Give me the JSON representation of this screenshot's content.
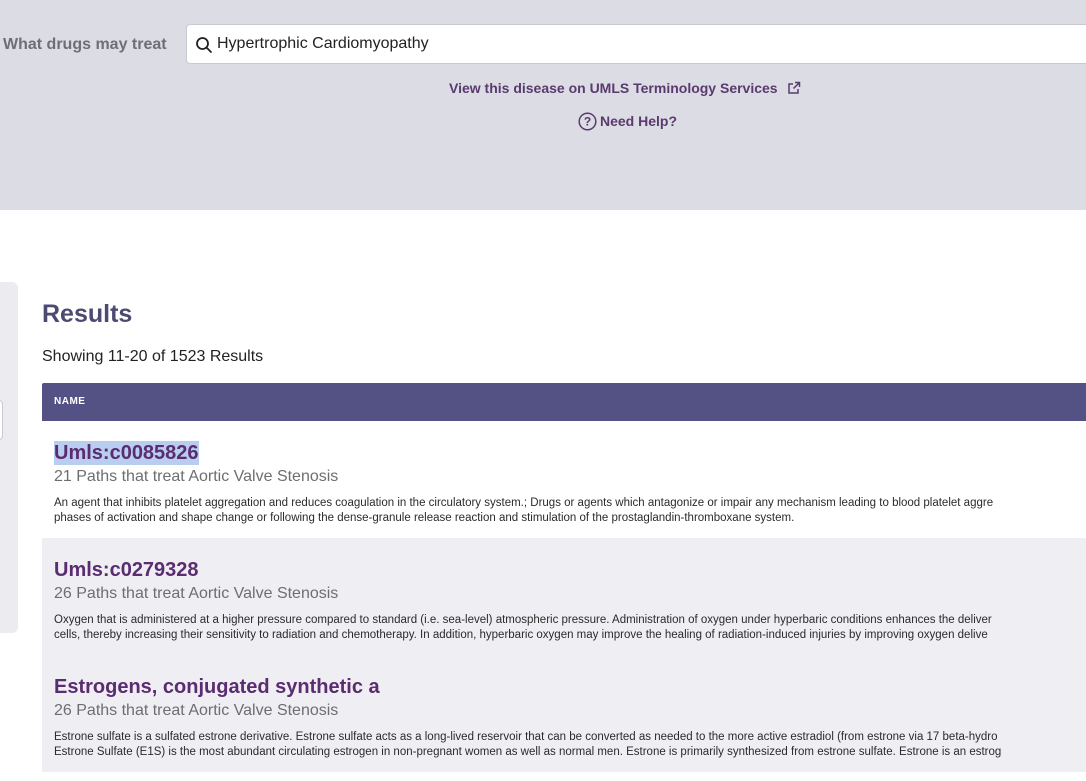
{
  "search": {
    "label": "What drugs may treat",
    "value": "Hypertrophic Cardiomyopathy"
  },
  "links": {
    "umls": "View this disease on UMLS Terminology Services",
    "help": "Need Help?"
  },
  "results": {
    "title": "Results",
    "count_text": "Showing 11-20 of 1523 Results",
    "column_header": "NAME",
    "items": [
      {
        "name": "Umls:c0085826",
        "paths": "21 Paths that treat Aortic Valve Stenosis",
        "desc_line1": "An agent that inhibits platelet aggregation and reduces coagulation in the circulatory system.; Drugs or agents which antagonize or impair any mechanism leading to blood platelet aggre",
        "desc_line2": "phases of activation and shape change or following the dense-granule release reaction and stimulation of the prostaglandin-thromboxane system."
      },
      {
        "name": "Umls:c0279328",
        "paths": "26 Paths that treat Aortic Valve Stenosis",
        "desc_line1": "Oxygen that is administered at a higher pressure compared to standard (i.e. sea-level) atmospheric pressure. Administration of oxygen under hyperbaric conditions enhances the deliver",
        "desc_line2": "cells, thereby increasing their sensitivity to radiation and chemotherapy. In addition, hyperbaric oxygen may improve the healing of radiation-induced injuries by improving oxygen delive"
      },
      {
        "name": "Estrogens, conjugated synthetic a",
        "paths": "26 Paths that treat Aortic Valve Stenosis",
        "desc_line1": "Estrone sulfate is a sulfated estrone derivative. Estrone sulfate acts as a long-lived reservoir that can be converted as needed to the more active estradiol (from estrone via 17 beta-hydro",
        "desc_line2": "Estrone Sulfate (E1S) is the most abundant circulating estrogen in non-pregnant women as well as normal men. Estrone is primarily synthesized from estrone sulfate. Estrone is an estrog"
      }
    ]
  },
  "colors": {
    "panel_bg": "#dcdce4",
    "header_bg": "#545184",
    "link": "#5a3a6e",
    "title": "#4d4a72"
  }
}
